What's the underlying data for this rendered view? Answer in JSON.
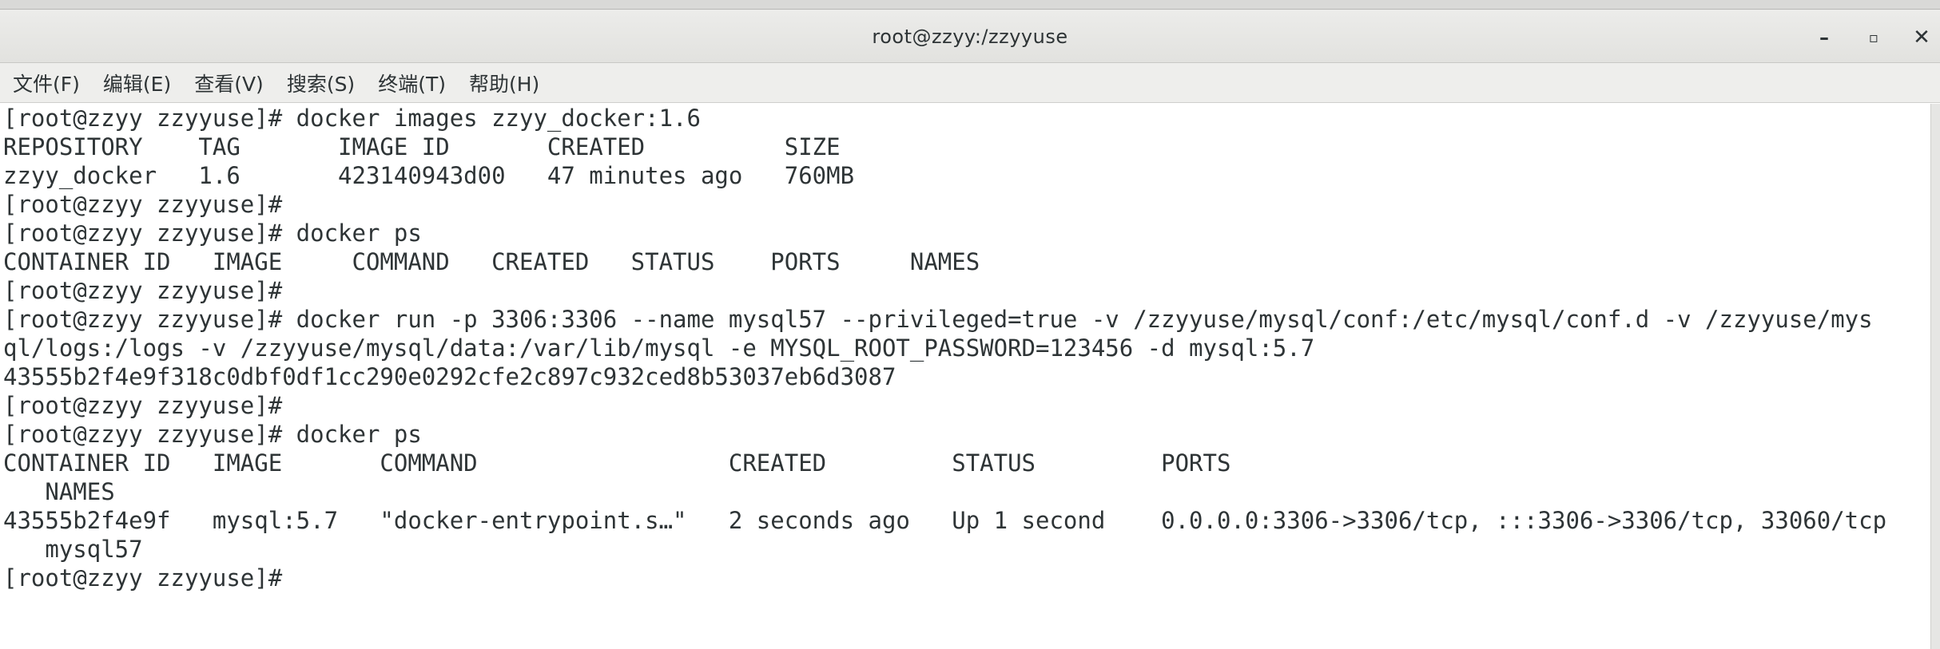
{
  "window": {
    "title": "root@zzyy:/zzyyuse",
    "minimize_label": "–",
    "maximize_label": "▫",
    "close_label": "✕"
  },
  "menu": [
    "文件(F)",
    "编辑(E)",
    "查看(V)",
    "搜索(S)",
    "终端(T)",
    "帮助(H)"
  ],
  "terminal_lines": [
    "[root@zzyy zzyyuse]# docker images zzyy_docker:1.6",
    "REPOSITORY    TAG       IMAGE ID       CREATED          SIZE",
    "zzyy_docker   1.6       423140943d00   47 minutes ago   760MB",
    "[root@zzyy zzyyuse]#",
    "[root@zzyy zzyyuse]# docker ps",
    "CONTAINER ID   IMAGE     COMMAND   CREATED   STATUS    PORTS     NAMES",
    "[root@zzyy zzyyuse]#",
    "[root@zzyy zzyyuse]# docker run -p 3306:3306 --name mysql57 --privileged=true -v /zzyyuse/mysql/conf:/etc/mysql/conf.d -v /zzyyuse/mys",
    "ql/logs:/logs -v /zzyyuse/mysql/data:/var/lib/mysql -e MYSQL_ROOT_PASSWORD=123456 -d mysql:5.7",
    "43555b2f4e9f318c0dbf0df1cc290e0292cfe2c897c932ced8b53037eb6d3087",
    "[root@zzyy zzyyuse]#",
    "[root@zzyy zzyyuse]# docker ps",
    "CONTAINER ID   IMAGE       COMMAND                  CREATED         STATUS         PORTS",
    "   NAMES",
    "43555b2f4e9f   mysql:5.7   \"docker-entrypoint.s…\"   2 seconds ago   Up 1 second    0.0.0.0:3306->3306/tcp, :::3306->3306/tcp, 33060/tcp",
    "   mysql57",
    "[root@zzyy zzyyuse]#"
  ]
}
